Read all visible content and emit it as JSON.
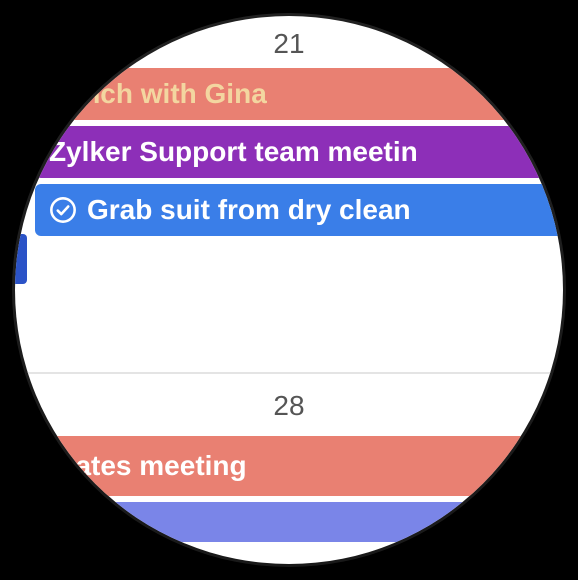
{
  "days": {
    "d21": {
      "number": "21",
      "events": {
        "lunch": {
          "title": "Lunch with Gina"
        },
        "zylker": {
          "title": "Zylker Support team meetin"
        },
        "grab": {
          "title": "Grab suit from dry clean",
          "icon": "check-circle"
        }
      }
    },
    "d28": {
      "number": "28",
      "events": {
        "delegates": {
          "title": "legates meeting"
        },
        "bottom": {
          "title": ""
        }
      }
    }
  }
}
